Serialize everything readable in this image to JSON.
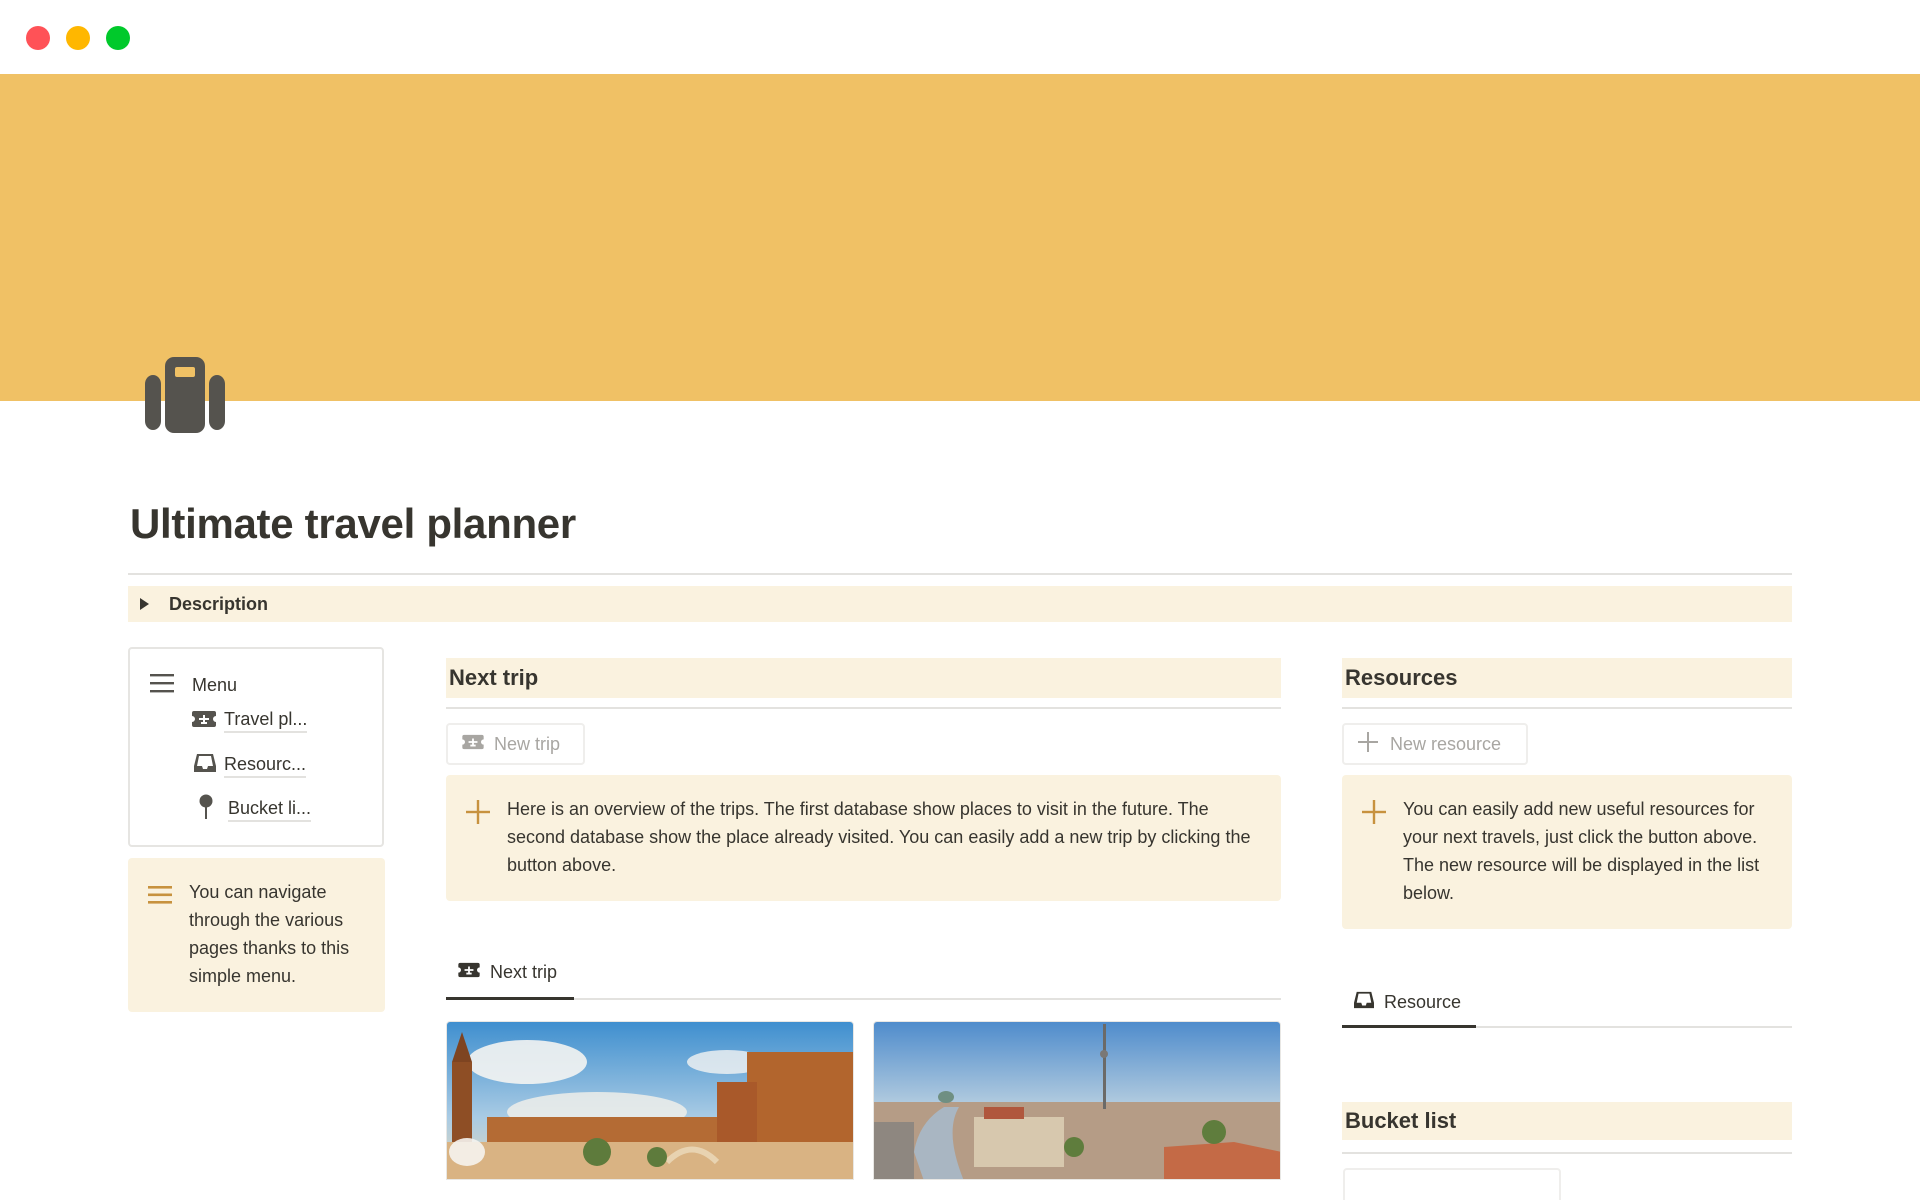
{
  "window": {
    "controls": [
      "close",
      "minimize",
      "maximize"
    ]
  },
  "colors": {
    "cover": "#f0c165",
    "callout_bg": "#faf2df",
    "accent_icon": "#c7923e",
    "text": "#37352f",
    "muted": "#a8a6a2"
  },
  "page": {
    "icon": "suitcase-icon",
    "title": "Ultimate travel planner",
    "description_toggle": "Description"
  },
  "menu": {
    "title": "Menu",
    "items": [
      {
        "label": "Travel pl...",
        "icon": "ticket-plane-icon"
      },
      {
        "label": "Resourc...",
        "icon": "inbox-tray-icon"
      },
      {
        "label": "Bucket li...",
        "icon": "pushpin-icon"
      }
    ],
    "callout": "You can navigate through the various pages thanks to this simple menu."
  },
  "next_trip": {
    "heading": "Next trip",
    "button_label": "New trip",
    "callout": "Here is an overview of the trips. The first database show places to visit in the future. The second database show the place already visited. You can easily add a new trip by clicking the button above.",
    "view_tab": "Next trip",
    "cards": [
      {
        "image": "Plaza de España, Seville"
      },
      {
        "image": "Berlin skyline with TV tower"
      }
    ]
  },
  "resources": {
    "heading": "Resources",
    "button_label": "New resource",
    "callout": "You can easily add new useful resources for your next travels, just click the button above. The new resource will be displayed in the list below.",
    "view_tab": "Resource"
  },
  "bucket_list": {
    "heading": "Bucket list"
  }
}
